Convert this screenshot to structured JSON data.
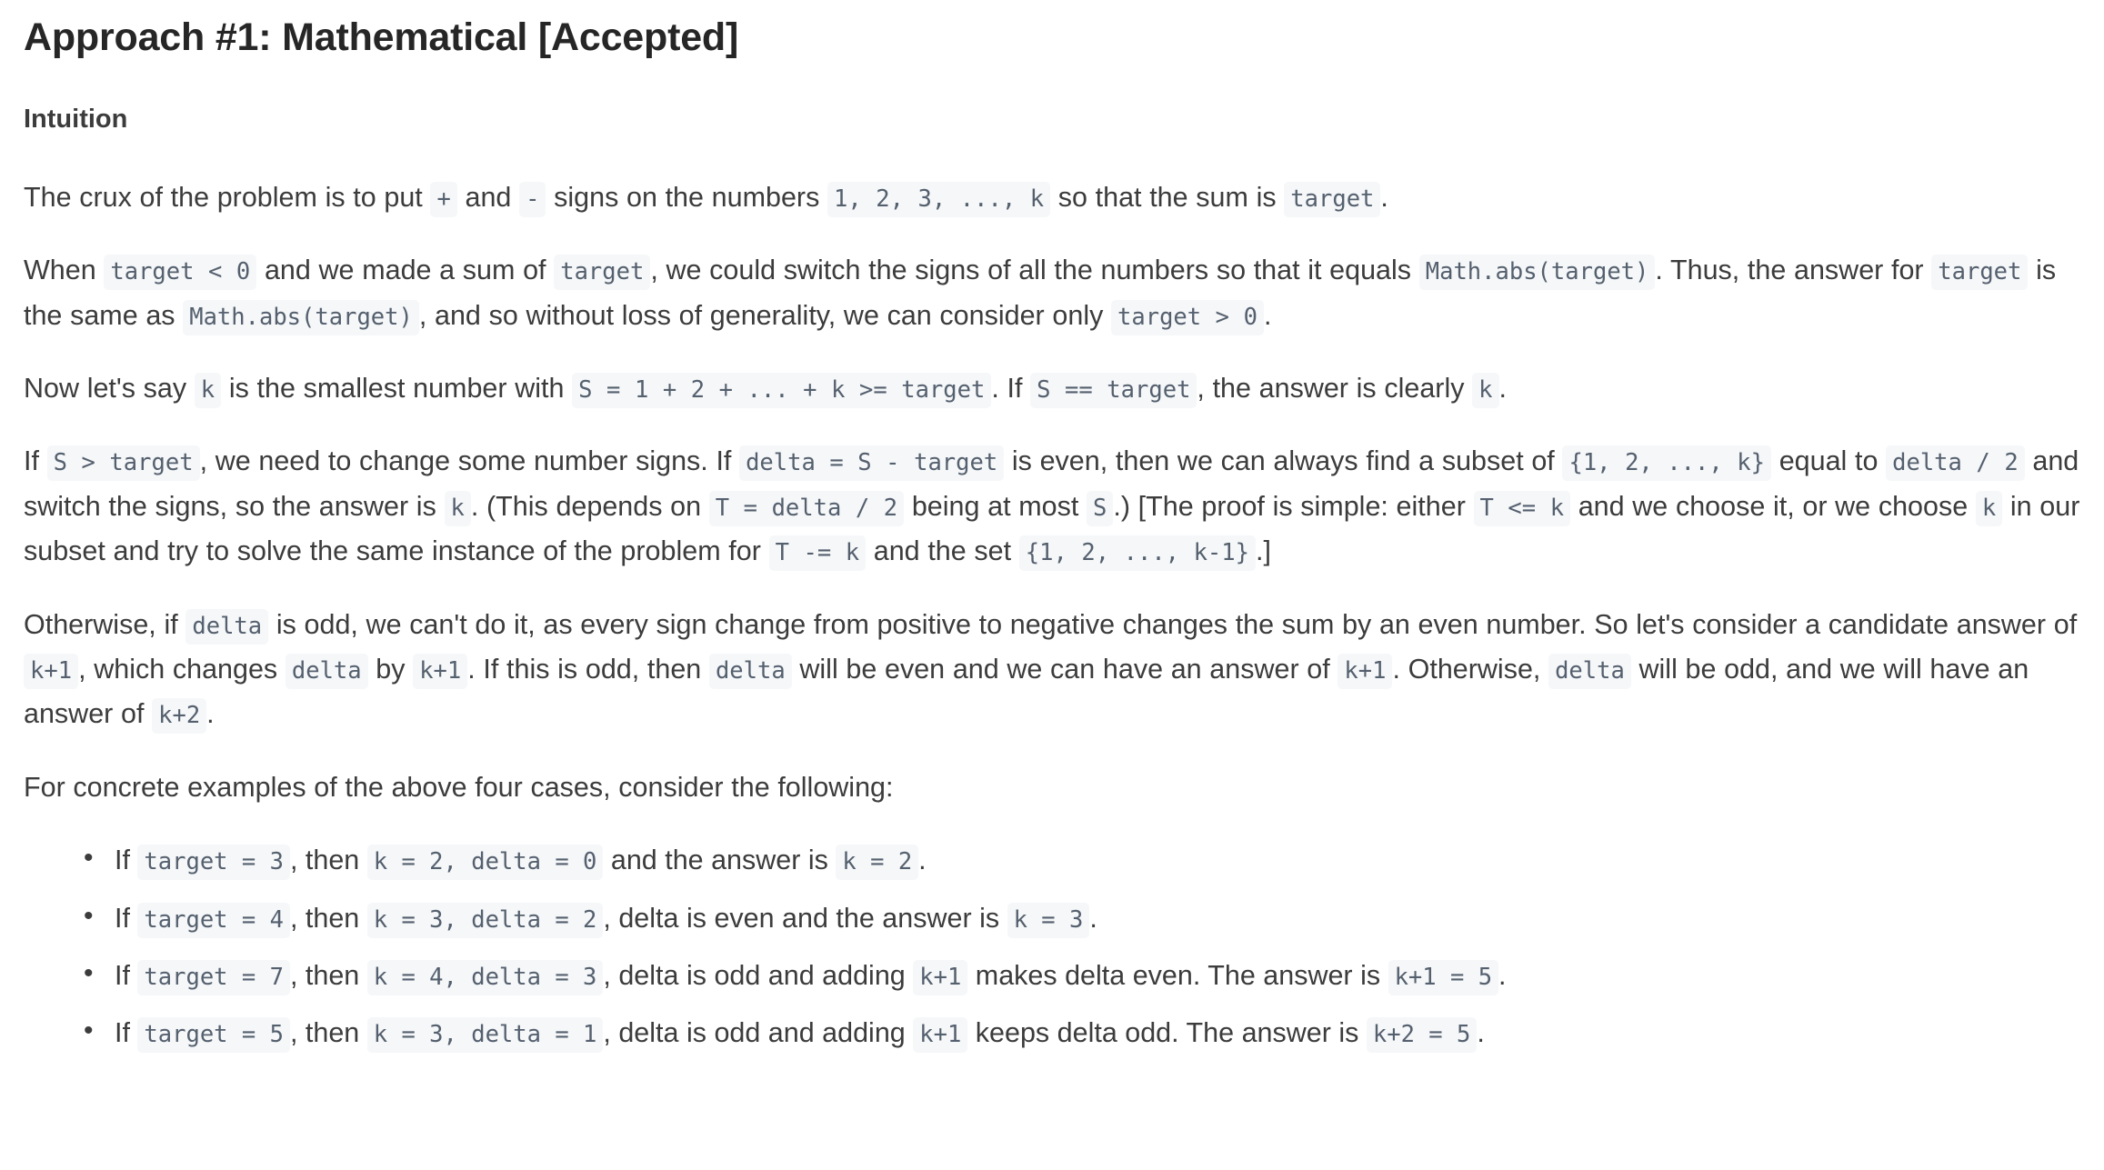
{
  "document": {
    "title": "Approach #1: Mathematical [Accepted]",
    "section_heading": "Intuition",
    "paragraphs": {
      "p1": {
        "t1": "The crux of the problem is to put ",
        "c1": "+",
        "t2": " and ",
        "c2": "-",
        "t3": " signs on the numbers ",
        "c3": "1, 2, 3, ..., k",
        "t4": " so that the sum is ",
        "c4": "target",
        "t5": "."
      },
      "p2": {
        "t1": "When ",
        "c1": "target < 0",
        "t2": " and we made a sum of ",
        "c2": "target",
        "t3": ", we could switch the signs of all the numbers so that it equals ",
        "c3": "Math.abs(target)",
        "t4": ". Thus, the answer for ",
        "c4": "target",
        "t5": " is the same as ",
        "c5": "Math.abs(target)",
        "t6": ", and so without loss of generality, we can consider only ",
        "c6": "target > 0",
        "t7": "."
      },
      "p3": {
        "t1": "Now let's say ",
        "c1": "k",
        "t2": " is the smallest number with ",
        "c2": "S = 1 + 2 + ... + k >= target",
        "t3": ". If ",
        "c3": "S == target",
        "t4": ", the answer is clearly ",
        "c4": "k",
        "t5": "."
      },
      "p4": {
        "t1": "If ",
        "c1": "S > target",
        "t2": ", we need to change some number signs. If ",
        "c2": "delta = S - target",
        "t3": " is even, then we can always find a subset of ",
        "c3": "{1, 2, ..., k}",
        "t4": " equal to ",
        "c4": "delta / 2",
        "t5": " and switch the signs, so the answer is ",
        "c5": "k",
        "t6": ". (This depends on ",
        "c6": "T = delta / 2",
        "t7": " being at most ",
        "c7": "S",
        "t8": ".) [The proof is simple: either ",
        "c8": "T <= k",
        "t9": " and we choose it, or we choose ",
        "c9": "k",
        "t10": " in our subset and try to solve the same instance of the problem for ",
        "c10": "T -= k",
        "t11": " and the set ",
        "c11": "{1, 2, ..., k-1}",
        "t12": ".]"
      },
      "p5": {
        "t1": "Otherwise, if ",
        "c1": "delta",
        "t2": " is odd, we can't do it, as every sign change from positive to negative changes the sum by an even number. So let's consider a candidate answer of ",
        "c2": "k+1",
        "t3": ", which changes ",
        "c3": "delta",
        "t4": " by ",
        "c4": "k+1",
        "t5": ". If this is odd, then ",
        "c5": "delta",
        "t6": " will be even and we can have an answer of ",
        "c6": "k+1",
        "t7": ". Otherwise, ",
        "c7": "delta",
        "t8": " will be odd, and we will have an answer of ",
        "c8": "k+2",
        "t9": "."
      },
      "p6": {
        "t1": "For concrete examples of the above four cases, consider the following:"
      }
    },
    "examples": [
      {
        "t1": "If ",
        "c1": "target = 3",
        "t2": ", then ",
        "c2": "k = 2, delta = 0",
        "t3": " and the answer is ",
        "c3": "k = 2",
        "t4": "."
      },
      {
        "t1": "If ",
        "c1": "target = 4",
        "t2": ", then ",
        "c2": "k = 3, delta = 2",
        "t3": ", delta is even and the answer is ",
        "c3": "k = 3",
        "t4": "."
      },
      {
        "t1": "If ",
        "c1": "target = 7",
        "t2": ", then ",
        "c2": "k = 4, delta = 3",
        "t3": ", delta is odd and adding ",
        "c3": "k+1",
        "t4": " makes delta even. The answer is ",
        "c4": "k+1 = 5",
        "t5": "."
      },
      {
        "t1": "If ",
        "c1": "target = 5",
        "t2": ", then ",
        "c2": "k = 3, delta = 1",
        "t3": ", delta is odd and adding ",
        "c3": "k+1",
        "t4": " keeps delta odd. The answer is ",
        "c4": "k+2 = 5",
        "t5": "."
      }
    ],
    "colors": {
      "text": "#3c3c3c",
      "heading": "#262626",
      "code_text": "#55606e",
      "code_background": "#f5f7f9",
      "page_background": "#ffffff"
    }
  }
}
